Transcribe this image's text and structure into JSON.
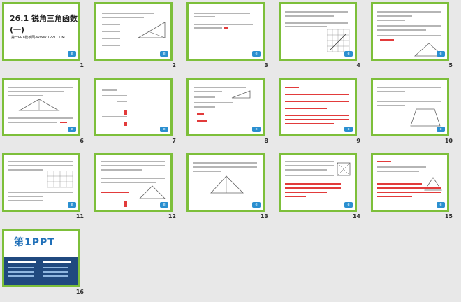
{
  "slides": [
    {
      "number": "1",
      "title": "26.1 锐角三角函数(一)",
      "subtitle": "第一PPT模板网-WWW.1PPT.COM"
    },
    {
      "number": "2"
    },
    {
      "number": "3"
    },
    {
      "number": "4"
    },
    {
      "number": "5"
    },
    {
      "number": "6"
    },
    {
      "number": "7"
    },
    {
      "number": "8"
    },
    {
      "number": "9"
    },
    {
      "number": "10"
    },
    {
      "number": "11"
    },
    {
      "number": "12"
    },
    {
      "number": "13"
    },
    {
      "number": "14"
    },
    {
      "number": "15"
    },
    {
      "number": "16",
      "brand": "第1PPT"
    }
  ],
  "colors": {
    "frame": "#7dbf3a",
    "background": "#e8e8e8",
    "accent_red": "#e23b3b",
    "brand_blue": "#1f6fb8"
  }
}
